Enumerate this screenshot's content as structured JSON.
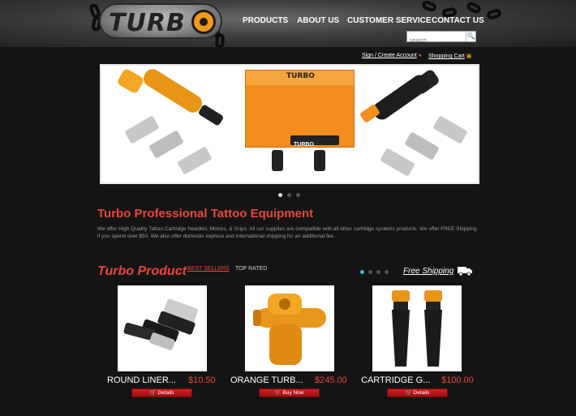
{
  "logo": {
    "text": "TURB"
  },
  "nav": {
    "products": "PRODUCTS",
    "about": "ABOUT US",
    "service": "CUSTOMER SERVICE",
    "contact": "CONTACT US"
  },
  "search": {
    "placeholder": "search",
    "icon": "search-icon"
  },
  "account": {
    "signin": "Sign / Create Account",
    "cart": "Shopping Cart"
  },
  "banner": {
    "box_brand": "TURBO",
    "box_label": "TURBO",
    "slide_dots": 3,
    "active_slide": 1
  },
  "intro": {
    "title": "Turbo Professional Tattoo Equipment",
    "text": "We offer High Quality Tattoo Cartridge Needles, Motors, & Grips. All our supplies are compatible with all other cartridge systems products. We offer FREE Shipping if you spend over $50. We also offer domestic express and international shipping for an additional fee."
  },
  "products_section": {
    "heading": "Turbo Product",
    "tabs": [
      {
        "label": "BEST SELLERS",
        "active": true
      },
      {
        "label": "TOP RATED",
        "active": false
      }
    ],
    "free_shipping": "Free Shipping",
    "carousel_dots": 4,
    "items": [
      {
        "name": "ROUND LINER...",
        "price": "$10.50",
        "button": "Details"
      },
      {
        "name": "ORANGE TURB...",
        "price": "$245.00",
        "button": "Buy Now"
      },
      {
        "name": "CARTRIDGE G...",
        "price": "$100.00",
        "button": "Details"
      }
    ]
  },
  "colors": {
    "accent_red": "#e8483a",
    "orange": "#f28d1e",
    "button_red": "#c41a1a",
    "background": "#141414"
  }
}
